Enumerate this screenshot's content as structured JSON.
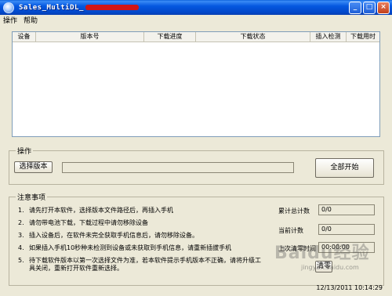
{
  "window": {
    "title": "Sales_MultiDL_",
    "controls": [
      "minimize-icon",
      "maximize-icon",
      "close-icon"
    ]
  },
  "menu": [
    "操作",
    "帮助"
  ],
  "table": {
    "columns": [
      "设备",
      "版本号",
      "下载进度",
      "下载状态",
      "插入检测",
      "下载用时"
    ],
    "rows": []
  },
  "operation": {
    "label": "操作",
    "select_version_button": "选择版本",
    "path_value": "",
    "start_all_button": "全部开始"
  },
  "notes": {
    "label": "注意事项",
    "items": [
      {
        "num": "1.",
        "text": "请先打开本软件，选择版本文件路径后，再插入手机"
      },
      {
        "num": "2.",
        "text": "请勿带电池下载，下载过程中请勿移除设备"
      },
      {
        "num": "3.",
        "text": "插入设备后，在软件未完全获取手机信息后，请勿移除设备。"
      },
      {
        "num": "4.",
        "text": "如果插入手机10秒种未检测到设备或未获取到手机信息，请重新插拔手机"
      },
      {
        "num": "5.",
        "text": "待下载软件版本以第一次选择文件为准，若本软件提示手机版本不正确，请将升级工具关闭，重新打开软件重新选择。"
      }
    ]
  },
  "stats": {
    "total_label": "累计总计数",
    "total_value": "0/0",
    "current_label": "当前计数",
    "current_value": "0/0",
    "last_clear_label": "上次清零时间",
    "last_clear_value": "00:00:00",
    "clear_button": "清零"
  },
  "status": {
    "datetime": "12/13/2011  10:14:29"
  },
  "watermark": {
    "main": "Baidu经验",
    "sub": "jingyan.baidu.com"
  }
}
